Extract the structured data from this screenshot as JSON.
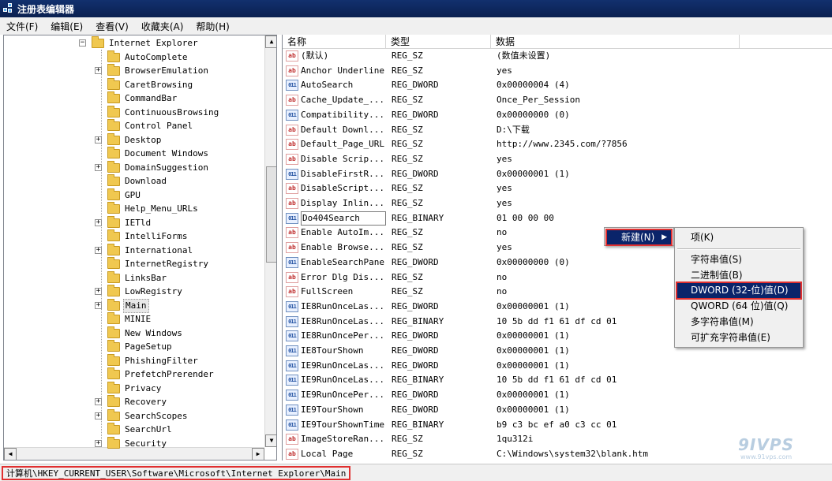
{
  "window": {
    "title": "注册表编辑器"
  },
  "menu": [
    "文件(F)",
    "编辑(E)",
    "查看(V)",
    "收藏夹(A)",
    "帮助(H)"
  ],
  "tree": {
    "parent": "Internet Explorer",
    "children": [
      {
        "label": "AutoComplete",
        "expandable": false
      },
      {
        "label": "BrowserEmulation",
        "expandable": true
      },
      {
        "label": "CaretBrowsing",
        "expandable": false
      },
      {
        "label": "CommandBar",
        "expandable": false
      },
      {
        "label": "ContinuousBrowsing",
        "expandable": false
      },
      {
        "label": "Control Panel",
        "expandable": false
      },
      {
        "label": "Desktop",
        "expandable": true
      },
      {
        "label": "Document Windows",
        "expandable": false
      },
      {
        "label": "DomainSuggestion",
        "expandable": true
      },
      {
        "label": "Download",
        "expandable": false
      },
      {
        "label": "GPU",
        "expandable": false
      },
      {
        "label": "Help_Menu_URLs",
        "expandable": false
      },
      {
        "label": "IETld",
        "expandable": true
      },
      {
        "label": "IntelliForms",
        "expandable": false
      },
      {
        "label": "International",
        "expandable": true
      },
      {
        "label": "InternetRegistry",
        "expandable": false
      },
      {
        "label": "LinksBar",
        "expandable": false
      },
      {
        "label": "LowRegistry",
        "expandable": true
      },
      {
        "label": "Main",
        "expandable": true,
        "selected": true
      },
      {
        "label": "MINIE",
        "expandable": false
      },
      {
        "label": "New Windows",
        "expandable": false
      },
      {
        "label": "PageSetup",
        "expandable": false
      },
      {
        "label": "PhishingFilter",
        "expandable": false
      },
      {
        "label": "PrefetchPrerender",
        "expandable": false
      },
      {
        "label": "Privacy",
        "expandable": false
      },
      {
        "label": "Recovery",
        "expandable": true
      },
      {
        "label": "SearchScopes",
        "expandable": true
      },
      {
        "label": "SearchUrl",
        "expandable": false
      },
      {
        "label": "Security",
        "expandable": true
      }
    ]
  },
  "columns": {
    "name": "名称",
    "type": "类型",
    "data": "数据"
  },
  "values": [
    {
      "icon": "ab",
      "name": "(默认)",
      "type": "REG_SZ",
      "data": "(数值未设置)"
    },
    {
      "icon": "ab",
      "name": "Anchor Underline",
      "type": "REG_SZ",
      "data": "yes"
    },
    {
      "icon": "bin",
      "name": "AutoSearch",
      "type": "REG_DWORD",
      "data": "0x00000004 (4)"
    },
    {
      "icon": "ab",
      "name": "Cache_Update_...",
      "type": "REG_SZ",
      "data": "Once_Per_Session"
    },
    {
      "icon": "bin",
      "name": "Compatibility...",
      "type": "REG_DWORD",
      "data": "0x00000000 (0)"
    },
    {
      "icon": "ab",
      "name": "Default Downl...",
      "type": "REG_SZ",
      "data": "D:\\下载"
    },
    {
      "icon": "ab",
      "name": "Default_Page_URL",
      "type": "REG_SZ",
      "data": "http://www.2345.com/?7856"
    },
    {
      "icon": "ab",
      "name": "Disable Scrip...",
      "type": "REG_SZ",
      "data": "yes"
    },
    {
      "icon": "bin",
      "name": "DisableFirstR...",
      "type": "REG_DWORD",
      "data": "0x00000001 (1)"
    },
    {
      "icon": "ab",
      "name": "DisableScript...",
      "type": "REG_SZ",
      "data": "yes"
    },
    {
      "icon": "ab",
      "name": "Display Inlin...",
      "type": "REG_SZ",
      "data": "yes"
    },
    {
      "icon": "bin",
      "name": "Do404Search",
      "type": "REG_BINARY",
      "data": "01 00 00 00",
      "editing": true
    },
    {
      "icon": "ab",
      "name": "Enable AutoIm...",
      "type": "REG_SZ",
      "data": "no"
    },
    {
      "icon": "ab",
      "name": "Enable Browse...",
      "type": "REG_SZ",
      "data": "yes"
    },
    {
      "icon": "bin",
      "name": "EnableSearchPane",
      "type": "REG_DWORD",
      "data": "0x00000000 (0)"
    },
    {
      "icon": "ab",
      "name": "Error Dlg Dis...",
      "type": "REG_SZ",
      "data": "no"
    },
    {
      "icon": "ab",
      "name": "FullScreen",
      "type": "REG_SZ",
      "data": "no"
    },
    {
      "icon": "bin",
      "name": "IE8RunOnceLas...",
      "type": "REG_DWORD",
      "data": "0x00000001 (1)"
    },
    {
      "icon": "bin",
      "name": "IE8RunOnceLas...",
      "type": "REG_BINARY",
      "data": "10 5b dd f1 61 df cd 01"
    },
    {
      "icon": "bin",
      "name": "IE8RunOncePer...",
      "type": "REG_DWORD",
      "data": "0x00000001 (1)"
    },
    {
      "icon": "bin",
      "name": "IE8TourShown",
      "type": "REG_DWORD",
      "data": "0x00000001 (1)"
    },
    {
      "icon": "bin",
      "name": "IE9RunOnceLas...",
      "type": "REG_DWORD",
      "data": "0x00000001 (1)"
    },
    {
      "icon": "bin",
      "name": "IE9RunOnceLas...",
      "type": "REG_BINARY",
      "data": "10 5b dd f1 61 df cd 01"
    },
    {
      "icon": "bin",
      "name": "IE9RunOncePer...",
      "type": "REG_DWORD",
      "data": "0x00000001 (1)"
    },
    {
      "icon": "bin",
      "name": "IE9TourShown",
      "type": "REG_DWORD",
      "data": "0x00000001 (1)"
    },
    {
      "icon": "bin",
      "name": "IE9TourShownTime",
      "type": "REG_BINARY",
      "data": "b9 c3 bc ef a0 c3 cc 01"
    },
    {
      "icon": "ab",
      "name": "ImageStoreRan...",
      "type": "REG_SZ",
      "data": "1qu312i"
    },
    {
      "icon": "ab",
      "name": "Local Page",
      "type": "REG_SZ",
      "data": "C:\\Windows\\system32\\blank.htm"
    }
  ],
  "context_menu": {
    "new_label": "新建(N)",
    "submenu": [
      {
        "label": "项(K)"
      },
      {
        "separator": true
      },
      {
        "label": "字符串值(S)"
      },
      {
        "label": "二进制值(B)"
      },
      {
        "label": "DWORD (32-位)值(D)",
        "active": true
      },
      {
        "label": "QWORD (64 位)值(Q)"
      },
      {
        "label": "多字符串值(M)"
      },
      {
        "label": "可扩充字符串值(E)"
      }
    ]
  },
  "status": {
    "path": "计算机\\HKEY_CURRENT_USER\\Software\\Microsoft\\Internet Explorer\\Main"
  },
  "watermark": {
    "brand": "9IVPS",
    "site": "www.91vps.com"
  },
  "colors": {
    "selection": "#0a246a",
    "highlight_box": "#e03030",
    "title_bar": "#12306e"
  }
}
